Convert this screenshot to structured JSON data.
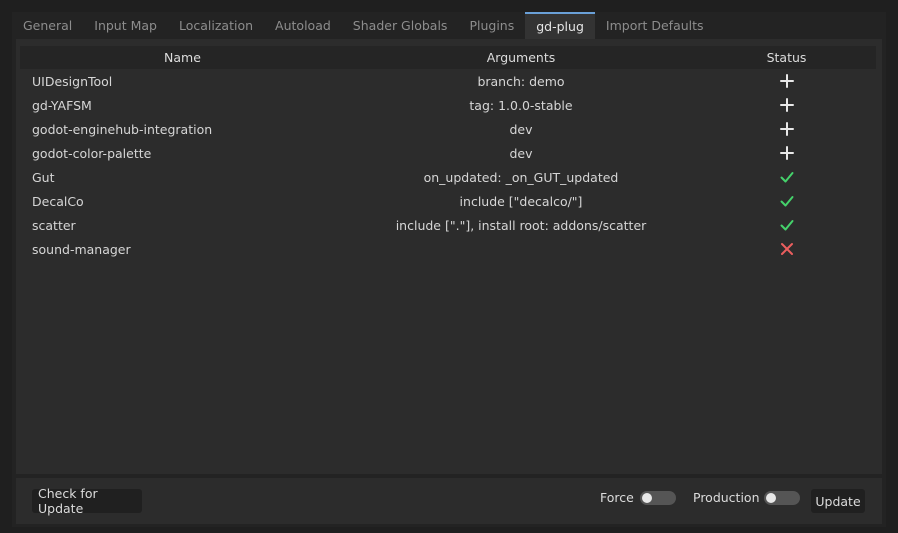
{
  "tabs": [
    {
      "label": "General",
      "active": false
    },
    {
      "label": "Input Map",
      "active": false
    },
    {
      "label": "Localization",
      "active": false
    },
    {
      "label": "Autoload",
      "active": false
    },
    {
      "label": "Shader Globals",
      "active": false
    },
    {
      "label": "Plugins",
      "active": false
    },
    {
      "label": "gd-plug",
      "active": true
    },
    {
      "label": "Import Defaults",
      "active": false
    }
  ],
  "table": {
    "headers": {
      "name": "Name",
      "arguments": "Arguments",
      "status": "Status"
    },
    "rows": [
      {
        "name": "UIDesignTool",
        "arguments": "branch: demo",
        "status": "add"
      },
      {
        "name": "gd-YAFSM",
        "arguments": "tag: 1.0.0-stable",
        "status": "add"
      },
      {
        "name": "godot-enginehub-integration",
        "arguments": "dev",
        "status": "add"
      },
      {
        "name": "godot-color-palette",
        "arguments": "dev",
        "status": "add"
      },
      {
        "name": "Gut",
        "arguments": "on_updated: _on_GUT_updated",
        "status": "installed"
      },
      {
        "name": "DecalCo",
        "arguments": "include [\"decalco/\"]",
        "status": "installed"
      },
      {
        "name": "scatter",
        "arguments": "include [\".\"], install root: addons/scatter",
        "status": "installed"
      },
      {
        "name": "sound-manager",
        "arguments": "",
        "status": "remove"
      }
    ]
  },
  "status_icons": {
    "add": "plus-icon",
    "installed": "checkmark-icon",
    "remove": "cross-icon"
  },
  "colors": {
    "add": "#e8e8e8",
    "installed": "#45d26b",
    "remove": "#ea5e5e",
    "tab_accent": "#6aa0d8"
  },
  "bottom": {
    "check_update_label": "Check for Update",
    "force_label": "Force",
    "force_on": false,
    "production_label": "Production",
    "production_on": false,
    "update_label": "Update"
  }
}
